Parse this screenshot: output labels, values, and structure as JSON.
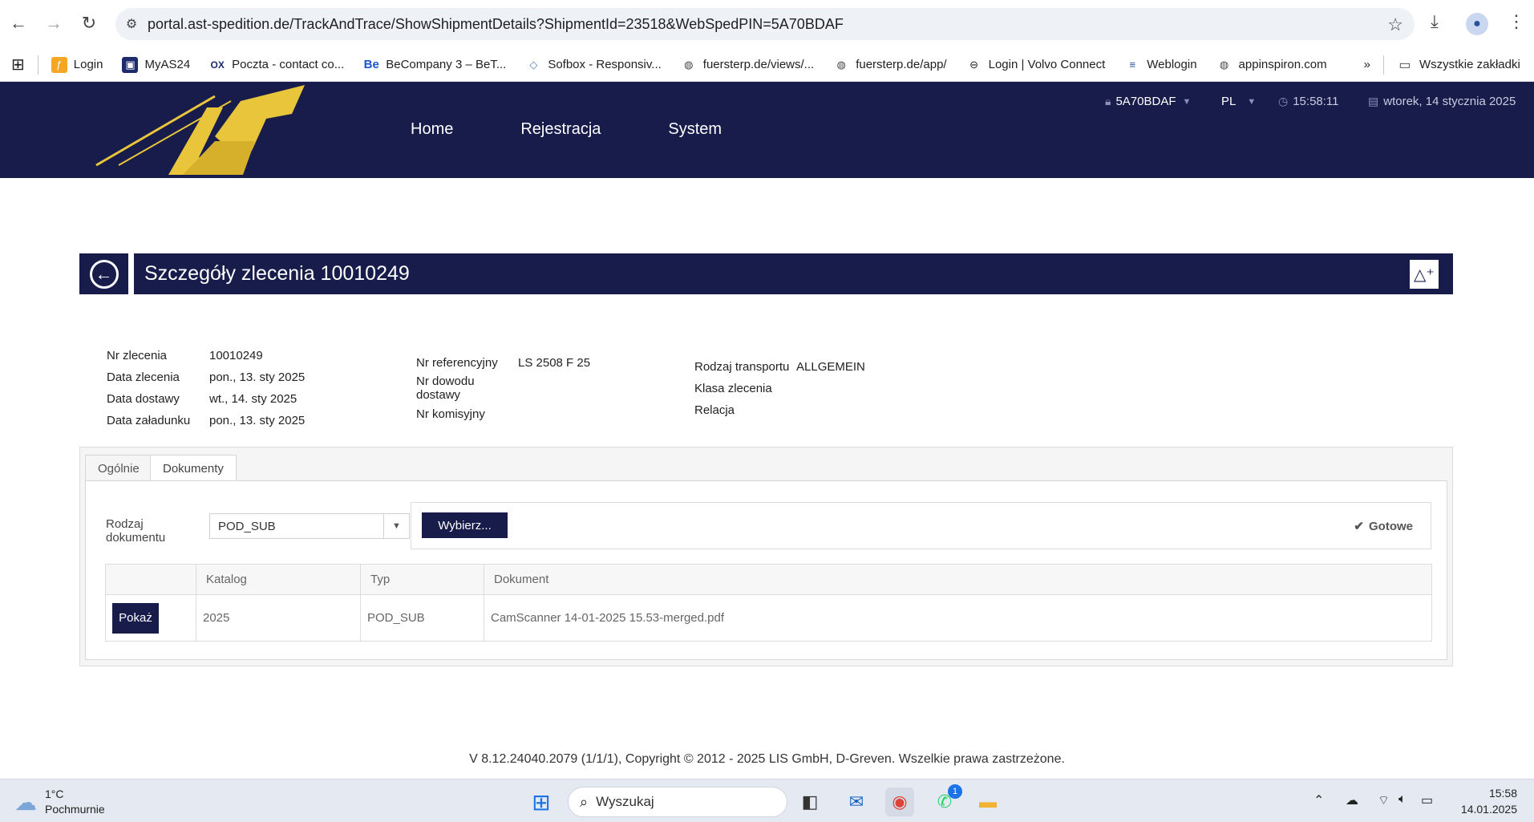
{
  "browser": {
    "url": "portal.ast-spedition.de/TrackAndTrace/ShowShipmentDetails?ShipmentId=23518&WebSpedPIN=5A70BDAF",
    "bookmarks": [
      {
        "label": "Login",
        "icon": "orange-square-icon"
      },
      {
        "label": "MyAS24",
        "icon": "as24-icon"
      },
      {
        "label": "Poczta - contact co...",
        "icon": "ox-icon"
      },
      {
        "label": "BeCompany 3 – BeT...",
        "icon": "be-icon"
      },
      {
        "label": "Sofbox - Responsiv...",
        "icon": "box-icon"
      },
      {
        "label": "fuersterp.de/views/...",
        "icon": "globe-icon"
      },
      {
        "label": "fuersterp.de/app/",
        "icon": "globe-icon"
      },
      {
        "label": "Login | Volvo Connect",
        "icon": "volvo-icon"
      },
      {
        "label": "Weblogin",
        "icon": "weblogin-icon"
      },
      {
        "label": "appinspiron.com",
        "icon": "globe-icon"
      }
    ],
    "all_bookmarks": "Wszystkie zakładki"
  },
  "header": {
    "nav": [
      "Home",
      "Rejestracja",
      "System"
    ],
    "pin": "5A70BDAF",
    "language": "PL",
    "time": "15:58:11",
    "date": "wtorek, 14 stycznia 2025"
  },
  "page": {
    "title": "Szczegóły zlecenia 10010249"
  },
  "details": {
    "col1": [
      {
        "label": "Nr zlecenia",
        "value": "10010249"
      },
      {
        "label": "Data zlecenia",
        "value": "pon., 13. sty 2025"
      },
      {
        "label": "Data dostawy",
        "value": "wt., 14. sty 2025"
      },
      {
        "label": "Data załadunku",
        "value": "pon., 13. sty 2025"
      }
    ],
    "col2": [
      {
        "label": "Nr referencyjny",
        "value": "LS 2508 F 25"
      },
      {
        "label_line1": "Nr dowodu",
        "label_line2": "dostawy",
        "value": ""
      },
      {
        "label": "Nr komisyjny",
        "value": ""
      }
    ],
    "col3": [
      {
        "label": "Rodzaj transportu",
        "value": "ALLGEMEIN"
      },
      {
        "label": "Klasa zlecenia",
        "value": ""
      },
      {
        "label": "Relacja",
        "value": ""
      }
    ]
  },
  "tabs": [
    "Ogólnie",
    "Dokumenty"
  ],
  "documents": {
    "type_label_line1": "Rodzaj",
    "type_label_line2": "dokumentu",
    "type_value": "POD_SUB",
    "choose_button": "Wybierz...",
    "status": "Gotowe",
    "columns": [
      "",
      "Katalog",
      "Typ",
      "Dokument"
    ],
    "rows": [
      {
        "action": "Pokaż",
        "catalog": "2025",
        "type": "POD_SUB",
        "document": "CamScanner 14-01-2025 15.53-merged.pdf"
      }
    ]
  },
  "footer": "V 8.12.24040.2079 (1/1/1), Copyright © 2012 - 2025 LIS GmbH, D-Greven. Wszelkie prawa zastrzeżone.",
  "taskbar": {
    "temperature": "1°C",
    "weather": "Pochmurnie",
    "search_placeholder": "Wyszukaj",
    "whatsapp_badge": "1",
    "time": "15:58",
    "date": "14.01.2025"
  }
}
